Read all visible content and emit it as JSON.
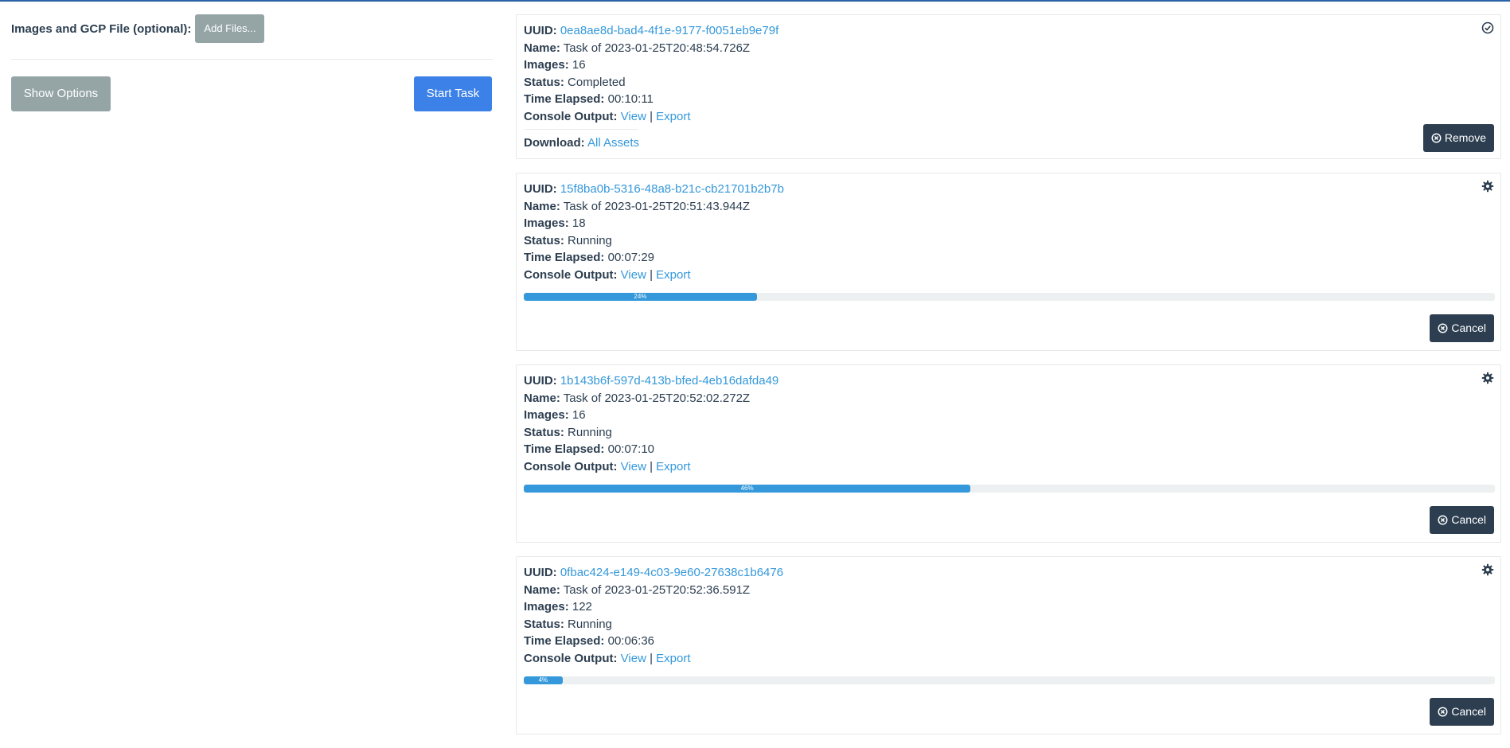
{
  "upload": {
    "label": "Images and GCP File (optional):",
    "add_files": "Add Files...",
    "show_options": "Show Options",
    "start_task": "Start Task"
  },
  "labels": {
    "uuid": "UUID:",
    "name": "Name:",
    "images": "Images:",
    "status": "Status:",
    "time_elapsed": "Time Elapsed:",
    "console_output": "Console Output:",
    "view": "View",
    "export": "Export",
    "pipe": "|",
    "download": "Download:"
  },
  "tasks": [
    {
      "uuid": "0ea8ae8d-bad4-4f1e-9177-f0051eb9e79f",
      "name": "Task of 2023-01-25T20:48:54.726Z",
      "images": "16",
      "status": "Completed",
      "time_elapsed": "00:10:11",
      "download_link": "All Assets",
      "action": "Remove",
      "corner_icon": "check-circle-icon"
    },
    {
      "uuid": "15f8ba0b-5316-48a8-b21c-cb21701b2b7b",
      "name": "Task of 2023-01-25T20:51:43.944Z",
      "images": "18",
      "status": "Running",
      "time_elapsed": "00:07:29",
      "progress": 24,
      "progress_label": "24%",
      "action": "Cancel",
      "corner_icon": "gear-icon"
    },
    {
      "uuid": "1b143b6f-597d-413b-bfed-4eb16dafda49",
      "name": "Task of 2023-01-25T20:52:02.272Z",
      "images": "16",
      "status": "Running",
      "time_elapsed": "00:07:10",
      "progress": 46,
      "progress_label": "46%",
      "action": "Cancel",
      "corner_icon": "gear-icon"
    },
    {
      "uuid": "0fbac424-e149-4c03-9e60-27638c1b6476",
      "name": "Task of 2023-01-25T20:52:36.591Z",
      "images": "122",
      "status": "Running",
      "time_elapsed": "00:06:36",
      "progress": 4,
      "progress_label": "4%",
      "action": "Cancel",
      "corner_icon": "gear-icon"
    }
  ],
  "colors": {
    "link": "#3498db",
    "progress": "#3498db",
    "dark_button": "#2c3e50",
    "grey_button": "#95a5a6",
    "primary_button": "#3c81e8"
  }
}
